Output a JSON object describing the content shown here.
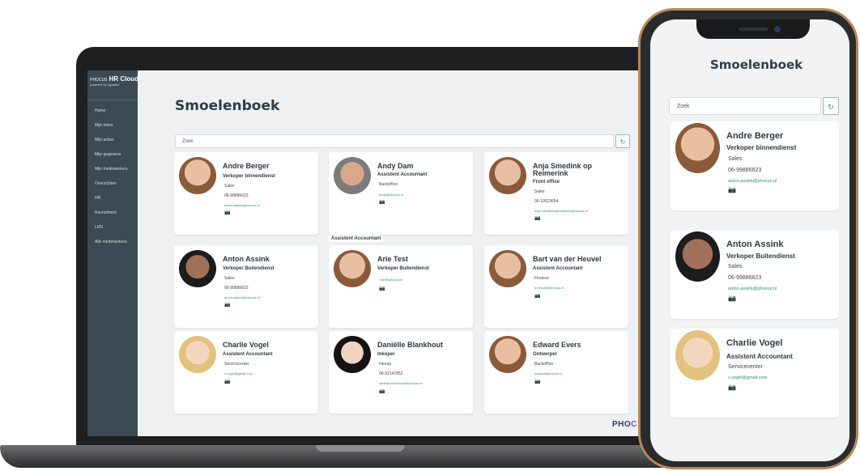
{
  "desktop": {
    "brand": {
      "name": "PHOCUS",
      "product": "HR Cloud",
      "tagline": "powered by 2gowise"
    },
    "nav": [
      "Home",
      "Mijn inbox",
      "Mijn acties",
      "Mijn gegevens",
      "Mijn medewerkers",
      "Overzichten",
      "HR",
      "Recruitment",
      "LMS",
      "Alle medewerkers"
    ],
    "title": "Smoelenboek",
    "search_placeholder": "Zoek",
    "refresh_icon": "↻",
    "floating_label": "Assistent Accountant",
    "logo": {
      "part1": "PHO",
      "part2": "C"
    },
    "cards": [
      {
        "name": "Andre Berger",
        "role": "Verkoper binnendienst",
        "dept": "Sales",
        "phone": "06-99886623",
        "email": "anton.assink@phocus.nl",
        "cam": "📷"
      },
      {
        "name": "Andy Dam",
        "role": "Assistent Accountant",
        "dept": "Backoffice",
        "phone": "",
        "email": "andy@phocus.nl",
        "cam": "📷"
      },
      {
        "name": "Anja Smedink op Reimerink",
        "role": "Front office",
        "dept": "Sales",
        "phone": "06-10523654",
        "email": "anja.smedinkopreimerink@phocus.nl",
        "cam": "📷"
      },
      {
        "name": "Anton Assink",
        "role": "Verkoper Buitendienst",
        "dept": "Sales",
        "phone": "06-99886623",
        "email": "anton.assink@phocus.nl",
        "cam": "📷"
      },
      {
        "name": "Arie Test",
        "role": "Verkoper Buitendienst",
        "dept": "",
        "phone": "",
        "email": "r-sel@phocus.nl",
        "cam": "📷"
      },
      {
        "name": "Bart van der Heuvel",
        "role": "Assistent Accountant",
        "dept": "Finance",
        "phone": "",
        "email": "b.heuvel@phocus.nl",
        "cam": "📷"
      },
      {
        "name": "Charlie Vogel",
        "role": "Assistent Accountant",
        "dept": "Servicecenter",
        "phone": "",
        "email": "c.vogel@gmail.com",
        "cam": "📷"
      },
      {
        "name": "Daniëlle Blankhout",
        "role": "Inkoper",
        "dept": "Inkoop",
        "phone": "06-32147852",
        "email": "danielle.blankhout@phocus.nl",
        "cam": "📷"
      },
      {
        "name": "Edward Evers",
        "role": "Ontwerper",
        "dept": "Backoffice",
        "phone": "",
        "email": "edward@phocus.nl",
        "cam": "📷"
      }
    ]
  },
  "mobile": {
    "title": "Smoelenboek",
    "search_placeholder": "Zoek",
    "refresh_icon": "↻",
    "cards": [
      {
        "name": "Andre Berger",
        "role": "Verkoper binnendienst",
        "dept": "Sales",
        "phone": "06-99886623",
        "email": "anton.assink@phocus.nl",
        "cam": "📷"
      },
      {
        "name": "Anton Assink",
        "role": "Verkoper Buitendienst",
        "dept": "Sales",
        "phone": "06-99886623",
        "email": "anton.assink@phocus.nl",
        "cam": "📷"
      },
      {
        "name": "Charlie Vogel",
        "role": "Assistent Accountant",
        "dept": "Servicecenter",
        "phone": "",
        "email": "c.vogel@gmail.com",
        "cam": "📷"
      }
    ]
  }
}
